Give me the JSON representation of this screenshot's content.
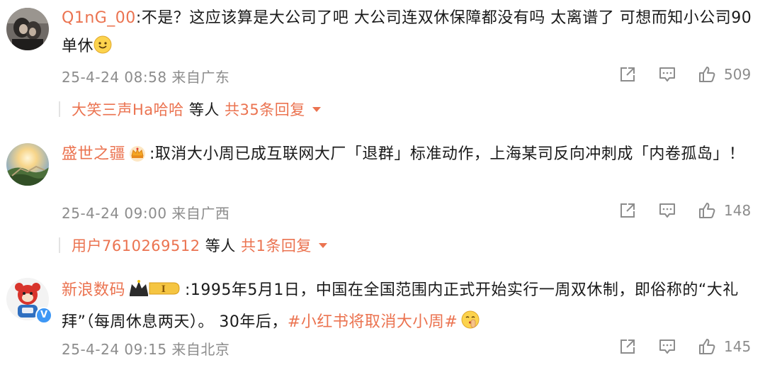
{
  "comments": [
    {
      "username": "Q1nG_00",
      "text": ":不是？这应该算是大公司了吧 大公司连双休保障都没有吗 太离谱了 可想而知小公司90单休",
      "timestamp": "25-4-24 08:58",
      "location": "来自广东",
      "likes": "509",
      "reply_user": "大笑三声Ha哈哈",
      "reply_joiner": "等人",
      "reply_count": "共35条回复",
      "emoji": "smile-emoji"
    },
    {
      "username": "盛世之疆",
      "text": ":取消大小周已成互联网大厂「退群」标准动作，上海某司反向冲刺成「内卷孤岛」！",
      "timestamp": "25-4-24 09:00",
      "location": "来自广西",
      "likes": "148",
      "reply_user": "用户7610269512",
      "reply_joiner": "等人",
      "reply_count": "共1条回复",
      "badge": "crown-icon"
    },
    {
      "username": "新浪数码",
      "text_before": ":1995年5月1日，中国在全国范围内正式开始实行一周双休制，即俗称的“大礼拜”（每周休息两天）。 30年后，",
      "hashtag": "#小红书将取消大小周#",
      "timestamp": "25-4-24 09:15",
      "location": "来自北京",
      "likes": "145",
      "badge": "vip-level-badge",
      "verified": "verified-v-icon",
      "emoji": "shush-emoji"
    }
  ],
  "colors": {
    "accent": "#eb7350",
    "meta": "#8c8c8c",
    "text": "#1a1a1a",
    "verified": "#3d97f5"
  }
}
